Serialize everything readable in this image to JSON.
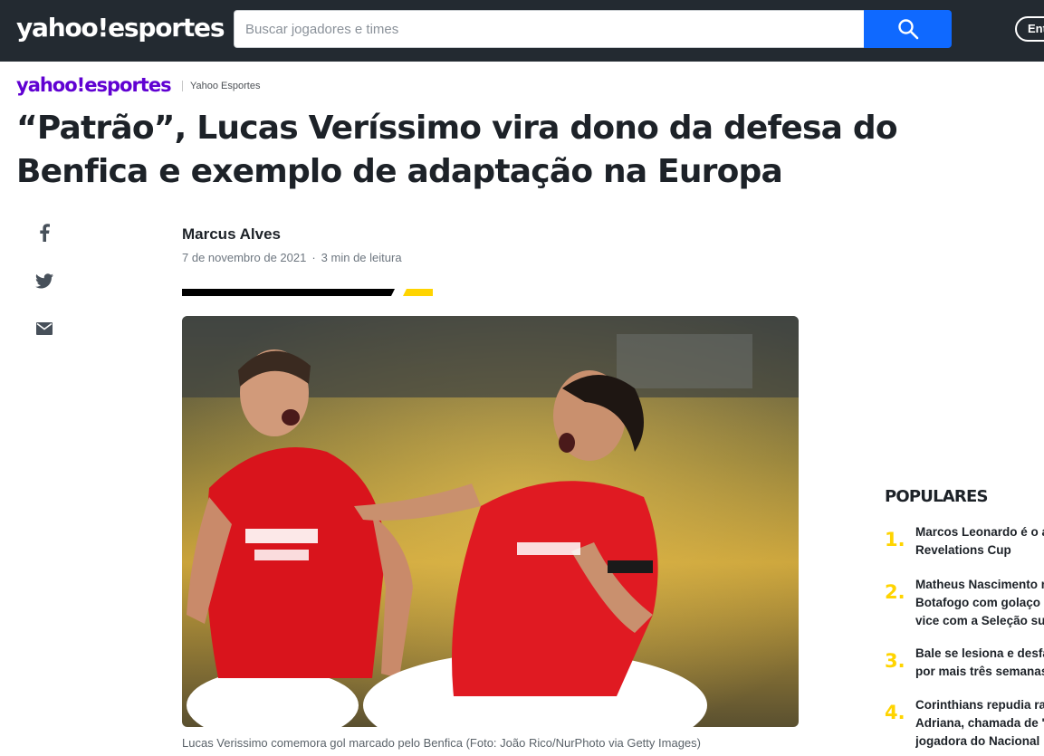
{
  "topbar": {
    "logo": "yahoo!esportes",
    "search_placeholder": "Buscar jogadores e times",
    "search_icon": "search-icon",
    "signin_label": "Entrar"
  },
  "brand": {
    "logo": "yahoo!esportes",
    "provider": "Yahoo Esportes",
    "logo_color": "#6001d2"
  },
  "article": {
    "headline": "“Patrão”, Lucas Veríssimo vira dono da defesa do Benfica e exemplo de adaptação na Europa",
    "author": "Marcus Alves",
    "date": "7 de novembro de 2021",
    "read_time": "3 min de leitura",
    "caption": "Lucas Verissimo comemora gol marcado pelo Benfica (Foto: João Rico/NurPhoto via Getty Images)"
  },
  "share": {
    "icons": [
      "facebook-icon",
      "twitter-icon",
      "mail-icon"
    ]
  },
  "populares": {
    "title": "POPULARES",
    "items": [
      {
        "num": "1.",
        "lines": [
          "Marcos Leonardo é o a",
          "Revelations Cup"
        ]
      },
      {
        "num": "2.",
        "lines": [
          "Matheus Nascimento r",
          "Botafogo com golaço s",
          "vice com a Seleção sub"
        ]
      },
      {
        "num": "3.",
        "lines": [
          "Bale se lesiona e desfa",
          "por mais três semanas"
        ]
      },
      {
        "num": "4.",
        "lines": [
          "Corinthians repudia ra",
          "Adriana, chamada de '",
          "jogadora do Nacional"
        ]
      }
    ]
  },
  "colors": {
    "topbar_bg": "#232a31",
    "search_button": "#0f69ff",
    "accent_yellow": "#ffd400"
  }
}
